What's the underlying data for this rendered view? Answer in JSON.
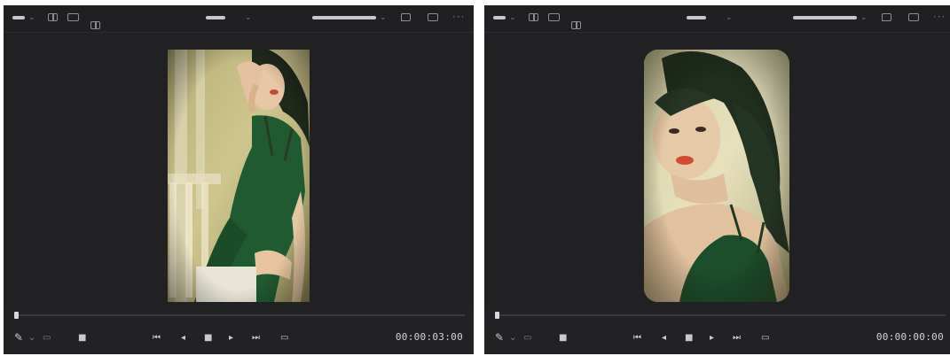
{
  "players": [
    {
      "timecode": "00:00:03:00"
    },
    {
      "timecode": "00:00:00:00"
    }
  ]
}
